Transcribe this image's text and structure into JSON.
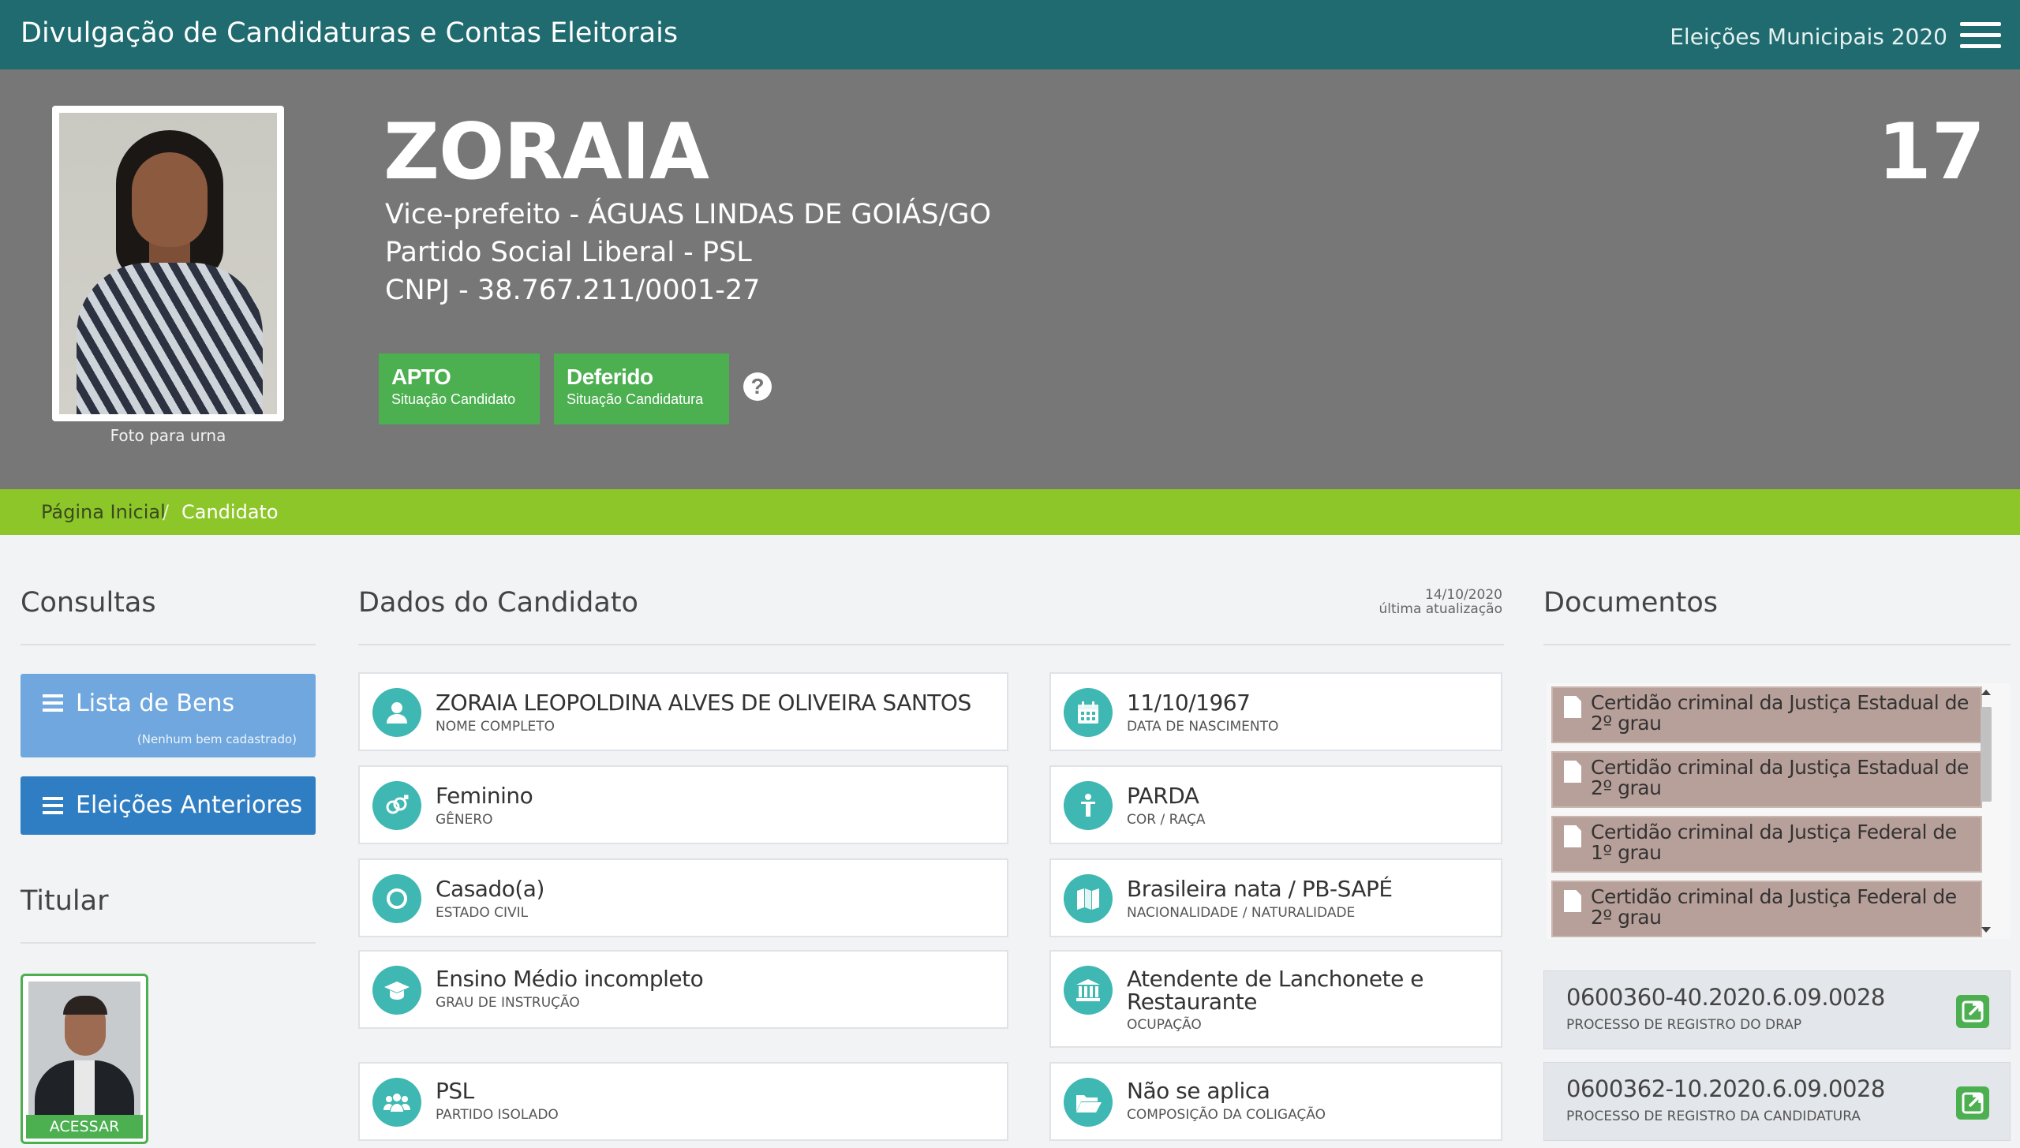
{
  "topbar": {
    "title": "Divulgação de Candidaturas e Contas Eleitorais",
    "election": "Eleições Municipais 2020",
    "menu_icon": "hamburger-menu-icon"
  },
  "candidate": {
    "name": "ZORAIA",
    "office": "Vice-prefeito - ÁGUAS LINDAS DE GOIÁS/GO",
    "party": "Partido Social Liberal - PSL",
    "cnpj": "CNPJ - 38.767.211/0001-27",
    "number": "17",
    "photo_caption": "Foto para urna",
    "status_candidate": {
      "value": "APTO",
      "label": "Situação Candidato",
      "color": "#4caf50"
    },
    "status_candidacy": {
      "value": "Deferido",
      "label": "Situação Candidatura",
      "color": "#4caf50"
    },
    "help_icon": "question-circle-icon"
  },
  "breadcrumb": {
    "home": "Página Inicial",
    "separator": "/",
    "current": "Candidato"
  },
  "consultas": {
    "title": "Consultas",
    "bens_label": "Lista de Bens",
    "bens_sub": "(Nenhum bem cadastrado)",
    "eleicoes_label": "Eleições Anteriores"
  },
  "titular": {
    "title": "Titular",
    "button": "ACESSAR"
  },
  "dados": {
    "title": "Dados do Candidato",
    "updated_date": "14/10/2020",
    "updated_label": "última atualização",
    "fields": [
      {
        "value": "ZORAIA LEOPOLDINA ALVES DE OLIVEIRA SANTOS",
        "caption": "NOME COMPLETO",
        "icon": "user-icon"
      },
      {
        "value": "11/10/1967",
        "caption": "DATA DE NASCIMENTO",
        "icon": "calendar-icon"
      },
      {
        "value": "Feminino",
        "caption": "GÊNERO",
        "icon": "gender-icon"
      },
      {
        "value": "PARDA",
        "caption": "COR / RAÇA",
        "icon": "person-icon"
      },
      {
        "value": "Casado(a)",
        "caption": "ESTADO CIVIL",
        "icon": "ring-icon"
      },
      {
        "value": "Brasileira nata / PB-SAPÉ",
        "caption": "NACIONALIDADE / NATURALIDADE",
        "icon": "map-icon"
      },
      {
        "value": "Ensino Médio incompleto",
        "caption": "GRAU DE INSTRUÇÃO",
        "icon": "graduation-cap-icon"
      },
      {
        "value": "Atendente de Lanchonete e Restaurante",
        "caption": "OCUPAÇÃO",
        "icon": "institution-icon"
      },
      {
        "value": "PSL",
        "caption": "PARTIDO ISOLADO",
        "icon": "users-icon"
      },
      {
        "value": "Não se aplica",
        "caption": "COMPOSIÇÃO DA COLIGAÇÃO",
        "icon": "folder-open-icon"
      }
    ]
  },
  "documentos": {
    "title": "Documentos",
    "items": [
      "Certidão criminal da Justiça Estadual de 2º grau",
      "Certidão criminal da Justiça Estadual de 2º grau",
      "Certidão criminal da Justiça Federal de 1º grau",
      "Certidão criminal da Justiça Federal de 2º grau"
    ],
    "processos": [
      {
        "number": "0600360-40.2020.6.09.0028",
        "caption": "PROCESSO DE REGISTRO DO DRAP"
      },
      {
        "number": "0600362-10.2020.6.09.0028",
        "caption": "PROCESSO DE REGISTRO DA CANDIDATURA"
      }
    ]
  }
}
